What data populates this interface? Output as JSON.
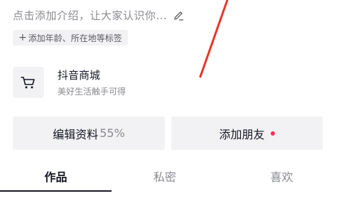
{
  "profile": {
    "intro_placeholder": "点击添加介绍，让大家认识你...",
    "tag_prompt": "添加年龄、所在地等标签"
  },
  "shop": {
    "title": "抖音商城",
    "subtitle": "美好生活触手可得"
  },
  "actions": {
    "edit_label": "编辑资料",
    "edit_progress": "55%",
    "add_friends_label": "添加朋友"
  },
  "tabs": [
    {
      "label": "作品",
      "active": true
    },
    {
      "label": "私密",
      "active": false
    },
    {
      "label": "喜欢",
      "active": false
    }
  ],
  "colors": {
    "accent": "#fe2c55",
    "annotation": "#e8352b"
  }
}
